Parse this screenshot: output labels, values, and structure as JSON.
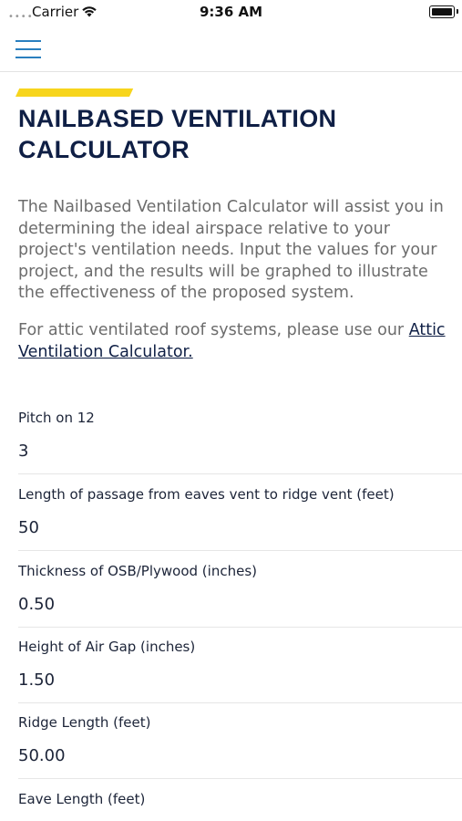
{
  "status_bar": {
    "signal": "••••",
    "carrier": "Carrier",
    "time": "9:36 AM",
    "battery_level": 1.0
  },
  "nav": {
    "menu_icon": "hamburger-menu-icon",
    "accent_color": "#2a7fbf"
  },
  "header": {
    "title_line1": "NAILBASED VENTILATION",
    "title_line2": "CALCULATOR",
    "accent_bar_color": "#f7d51d",
    "title_color": "#0f1f45"
  },
  "intro": {
    "paragraph": "The Nailbased Ventilation Calculator will assist you in determining the ideal airspace relative to your project's ventilation needs. Input the values for your project, and the results will be graphed to illustrate the effectiveness of the proposed system.",
    "attic_prefix": "For attic ventilated roof systems, please use our ",
    "attic_link": "Attic Ventilation Calculator."
  },
  "fields": [
    {
      "label": "Pitch on 12",
      "value": "3"
    },
    {
      "label": "Length of passage from eaves vent to ridge vent (feet)",
      "value": "50"
    },
    {
      "label": "Thickness of OSB/Plywood (inches)",
      "value": "0.50"
    },
    {
      "label": "Height of Air Gap (inches)",
      "value": "1.50"
    },
    {
      "label": "Ridge Length (feet)",
      "value": "50.00"
    },
    {
      "label": "Eave Length (feet)",
      "value": ""
    }
  ]
}
